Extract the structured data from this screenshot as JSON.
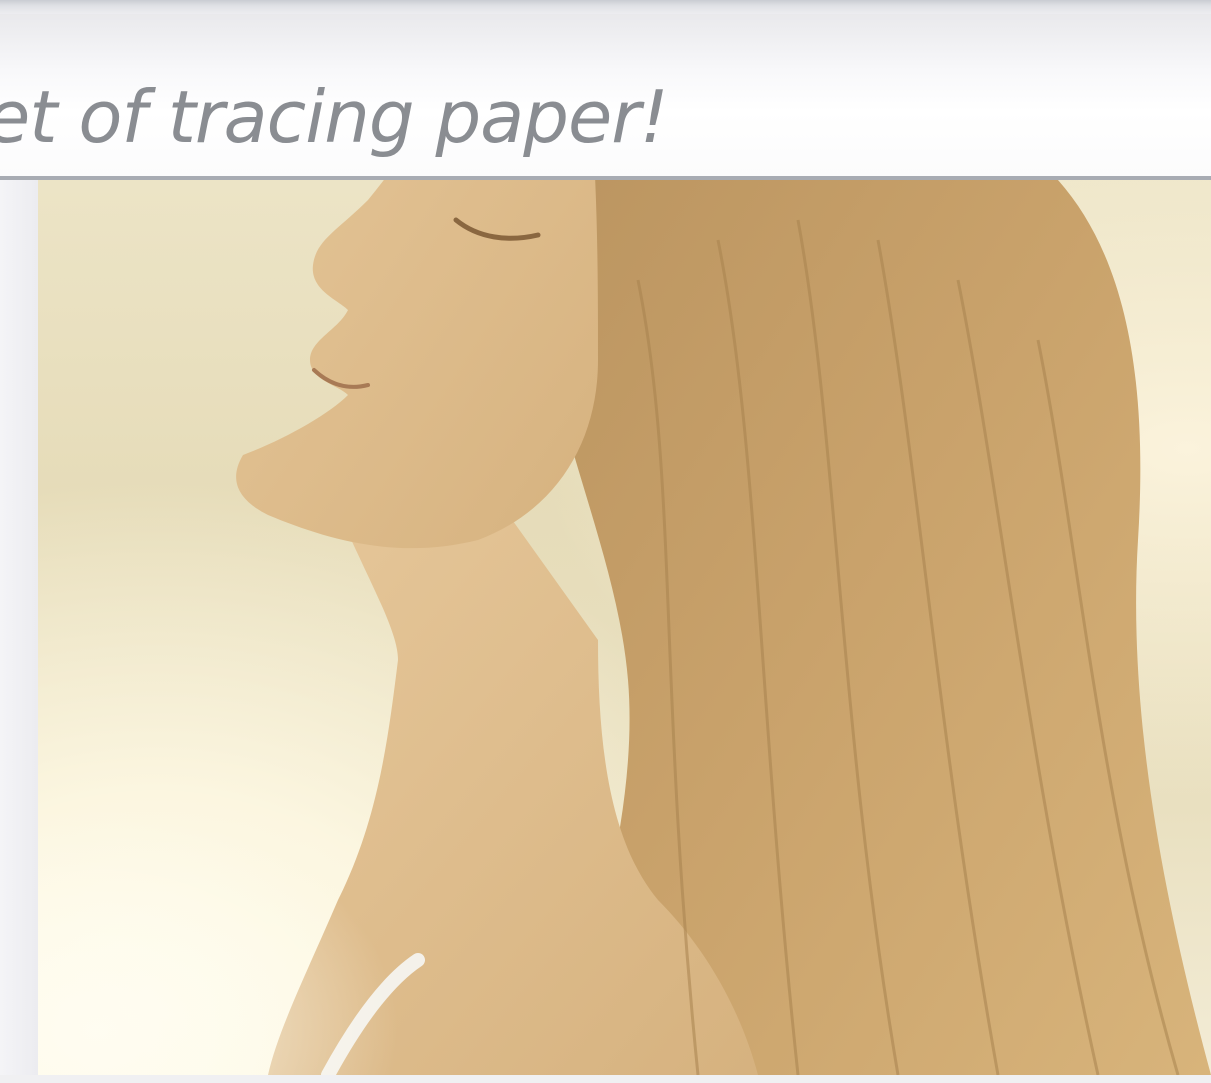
{
  "headline": {
    "text": "et of tracing paper!"
  },
  "photo": {
    "subject_icon": "woman-profile-photo",
    "colors": {
      "background": "#e9e0c0",
      "hair": "#c7a06a",
      "skin": "#e0bf92"
    }
  }
}
